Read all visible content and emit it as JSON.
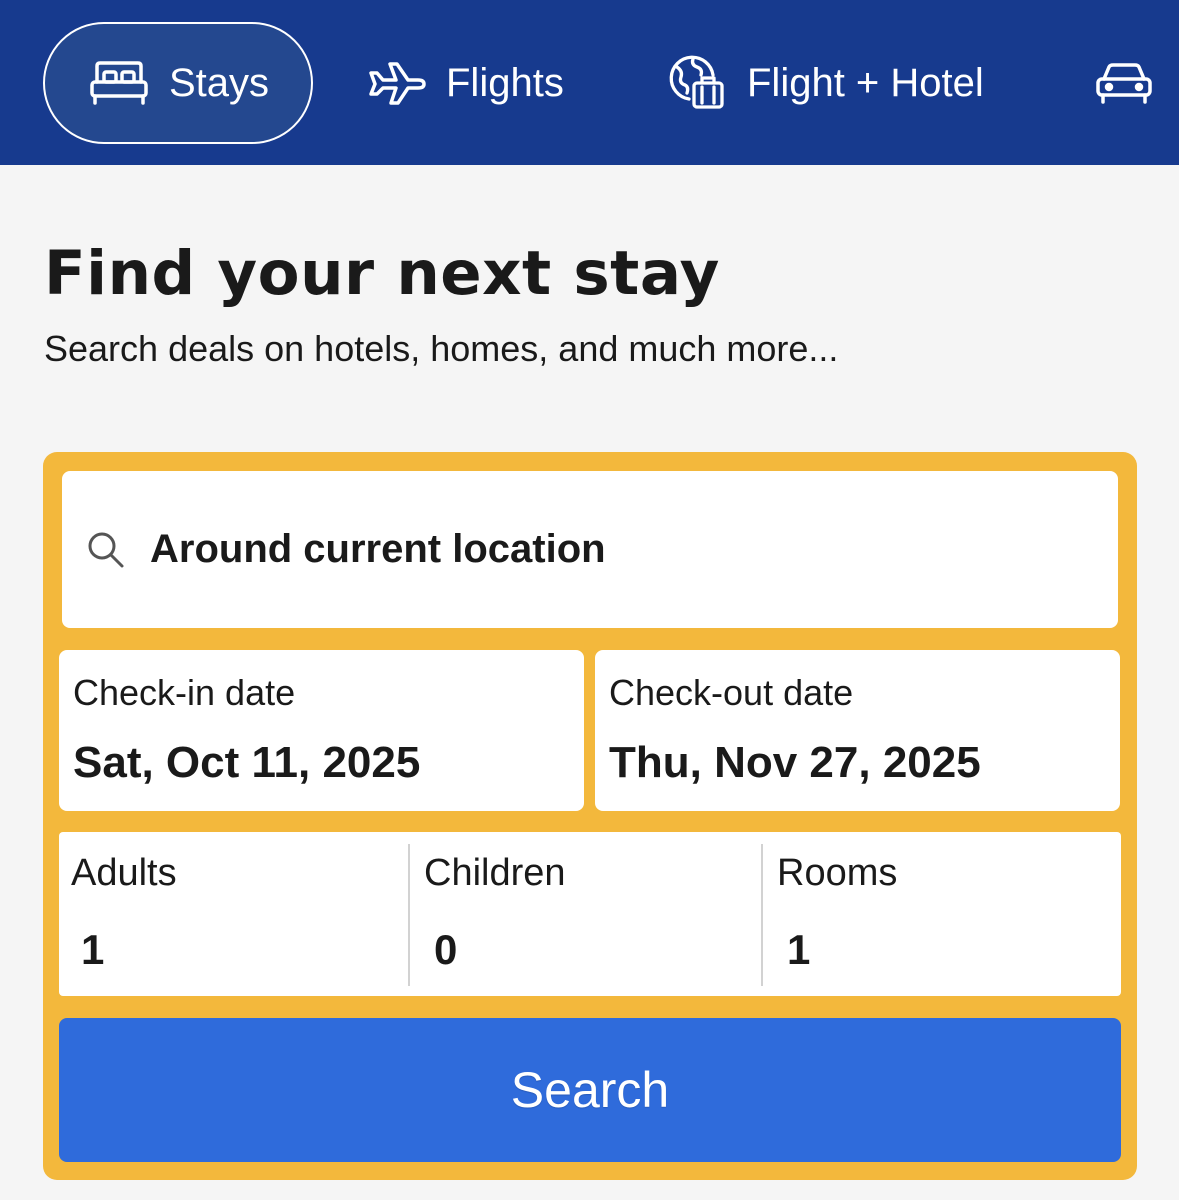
{
  "nav": {
    "tabs": [
      {
        "label": "Stays",
        "icon": "bed-icon",
        "selected": true
      },
      {
        "label": "Flights",
        "icon": "airplane-icon",
        "selected": false
      },
      {
        "label": "Flight + Hotel",
        "icon": "globe-luggage-icon",
        "selected": false
      },
      {
        "label": "",
        "icon": "car-icon",
        "selected": false
      }
    ]
  },
  "header": {
    "title": "Find your next stay",
    "subtitle": "Search deals on hotels, homes, and much more..."
  },
  "search": {
    "destination": {
      "icon": "search-icon",
      "value": "Around current location"
    },
    "checkin": {
      "label": "Check-in date",
      "value": "Sat, Oct 11, 2025"
    },
    "checkout": {
      "label": "Check-out date",
      "value": "Thu, Nov 27, 2025"
    },
    "occupancy": [
      {
        "label": "Adults",
        "value": "1"
      },
      {
        "label": "Children",
        "value": "0"
      },
      {
        "label": "Rooms",
        "value": "1"
      }
    ],
    "button_label": "Search"
  },
  "colors": {
    "nav_background": "#173a8e",
    "panel_accent": "#f3b83c",
    "button_primary": "#2f6bdb",
    "page_background": "#f5f5f5"
  }
}
